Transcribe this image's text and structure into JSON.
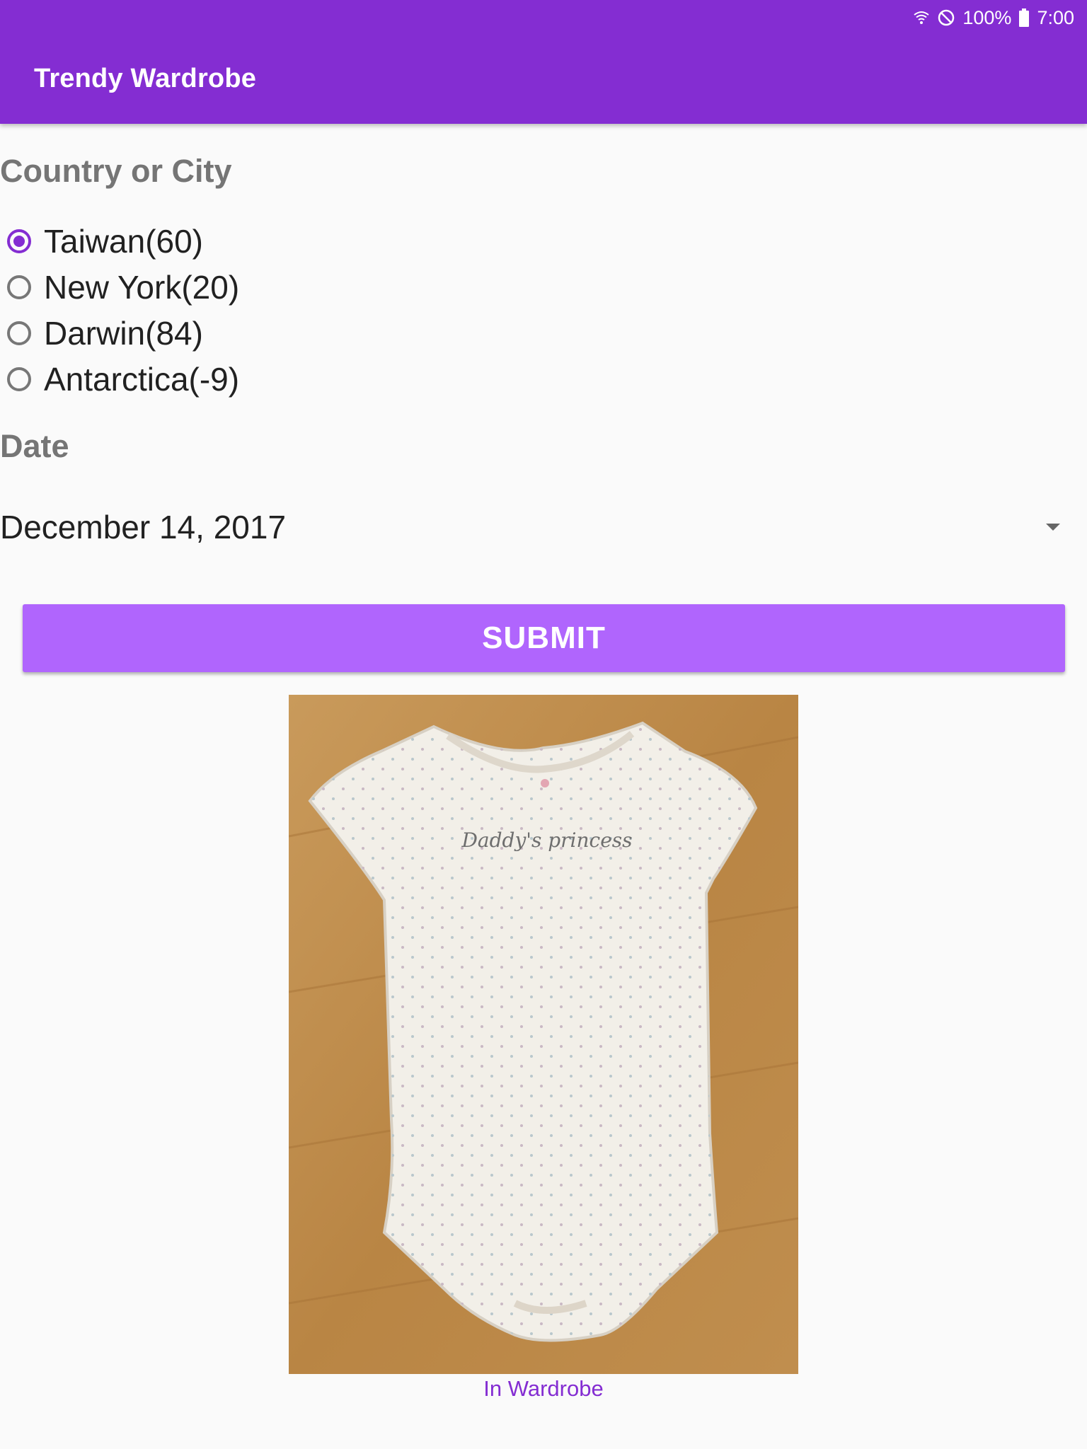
{
  "status_bar": {
    "battery": "100%",
    "time": "7:00",
    "icons": [
      "wifi-icon",
      "do-not-disturb-icon",
      "battery-icon"
    ]
  },
  "app": {
    "title": "Trendy Wardrobe"
  },
  "form": {
    "country_label": "Country or City",
    "options": [
      {
        "label": "Taiwan(60)",
        "checked": true
      },
      {
        "label": "New York(20)",
        "checked": false
      },
      {
        "label": "Darwin(84)",
        "checked": false
      },
      {
        "label": "Antarctica(-9)",
        "checked": false
      }
    ],
    "date_label": "Date",
    "date_value": "December 14, 2017",
    "submit_label": "SUBMIT"
  },
  "result": {
    "garment_text": "Daddy's princess",
    "caption": "In Wardrobe"
  },
  "colors": {
    "primary": "#842dd2",
    "button": "#b065fd",
    "background": "#fafafa"
  }
}
